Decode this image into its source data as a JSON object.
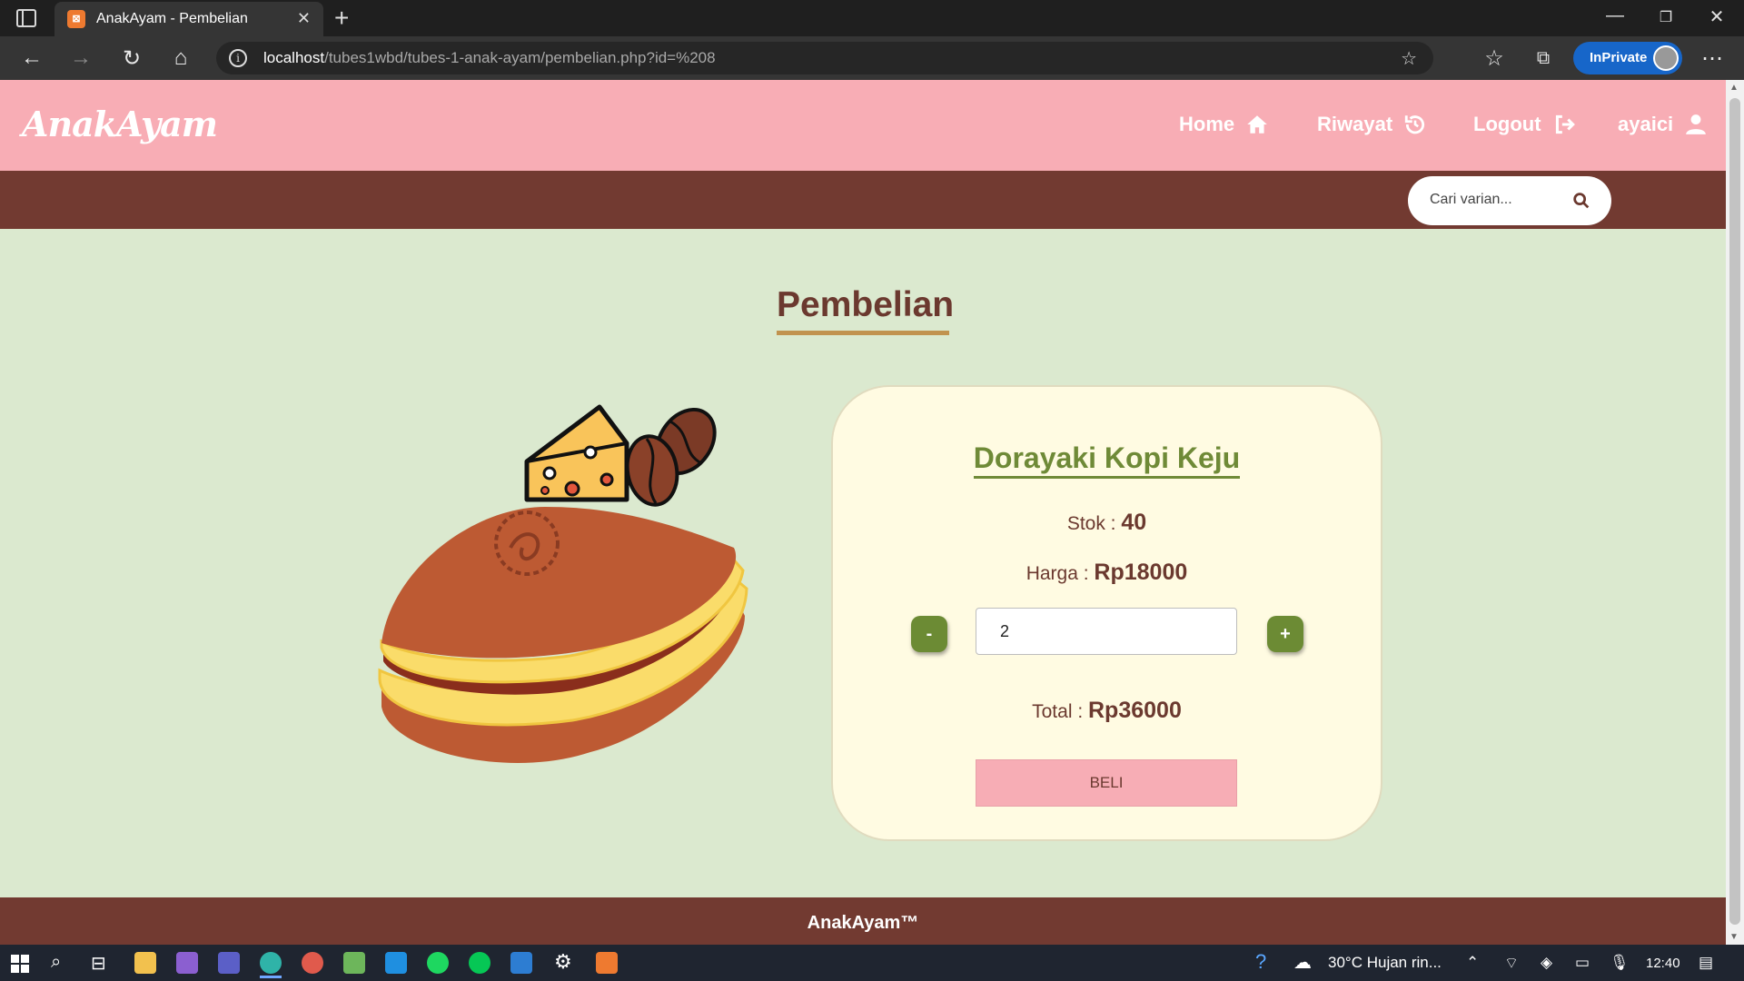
{
  "browser": {
    "tab_title": "AnakAyam - Pembelian",
    "url_host": "localhost",
    "url_path": "/tubes1wbd/tubes-1-anak-ayam/pembelian.php?id=%208",
    "inprivate_label": "InPrivate"
  },
  "header": {
    "logo": "AnakAyam",
    "nav": [
      {
        "label": "Home",
        "icon": "home-icon"
      },
      {
        "label": "Riwayat",
        "icon": "history-icon"
      },
      {
        "label": "Logout",
        "icon": "logout-icon"
      },
      {
        "label": "ayaici",
        "icon": "user-icon"
      }
    ]
  },
  "search": {
    "placeholder": "Cari varian..."
  },
  "page_title": "Pembelian",
  "product": {
    "name": "Dorayaki Kopi Keju",
    "stok_label": "Stok :",
    "stok_value": "40",
    "harga_label": "Harga :",
    "harga_value": "Rp18000",
    "minus_label": "-",
    "plus_label": "+",
    "quantity": "2",
    "total_label": "Total :",
    "total_value": "Rp36000",
    "buy_label": "BELI"
  },
  "footer": {
    "text": "AnakAyam™"
  },
  "taskbar": {
    "weather": "30°C  Hujan rin...",
    "time": "12:40"
  },
  "colors": {
    "header_pink": "#f8adb5",
    "brown": "#723a31",
    "page_green": "#dbe9cf",
    "card_cream": "#fffbe2",
    "olive": "#6f8a37"
  }
}
